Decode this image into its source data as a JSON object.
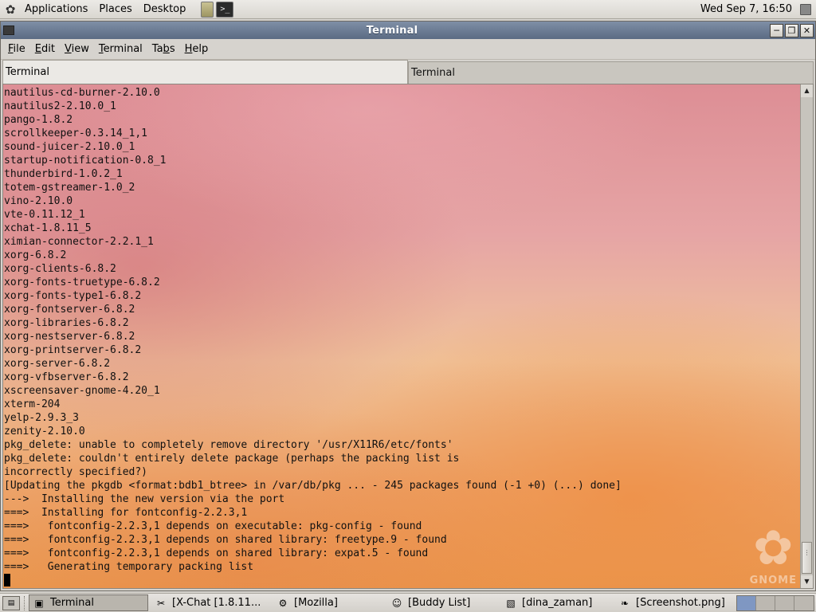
{
  "top_panel": {
    "menus": [
      "Applications",
      "Places",
      "Desktop"
    ],
    "clock": "Wed Sep  7, 16:50",
    "icons": [
      "gnome-foot-icon",
      "notes-launcher-icon",
      "terminal-launcher-icon",
      "tray-icon"
    ]
  },
  "window": {
    "title": "Terminal",
    "menubar": [
      {
        "label": "File",
        "mnemonic": "F",
        "rest": "ile"
      },
      {
        "label": "Edit",
        "mnemonic": "E",
        "rest": "dit"
      },
      {
        "label": "View",
        "mnemonic": "V",
        "rest": "iew"
      },
      {
        "label": "Terminal",
        "mnemonic": "T",
        "rest": "erminal"
      },
      {
        "label": "Tabs",
        "pre": "Ta",
        "mnemonic": "b",
        "rest": "s"
      },
      {
        "label": "Help",
        "mnemonic": "H",
        "rest": "elp"
      }
    ],
    "tabs": [
      "Terminal",
      "Terminal"
    ],
    "buttons": [
      "minimize",
      "maximize",
      "close"
    ]
  },
  "terminal": {
    "lines": [
      "nautilus-cd-burner-2.10.0",
      "nautilus2-2.10.0_1",
      "pango-1.8.2",
      "scrollkeeper-0.3.14_1,1",
      "sound-juicer-2.10.0_1",
      "startup-notification-0.8_1",
      "thunderbird-1.0.2_1",
      "totem-gstreamer-1.0_2",
      "vino-2.10.0",
      "vte-0.11.12_1",
      "xchat-1.8.11_5",
      "ximian-connector-2.2.1_1",
      "xorg-6.8.2",
      "xorg-clients-6.8.2",
      "xorg-fonts-truetype-6.8.2",
      "xorg-fonts-type1-6.8.2",
      "xorg-fontserver-6.8.2",
      "xorg-libraries-6.8.2",
      "xorg-nestserver-6.8.2",
      "xorg-printserver-6.8.2",
      "xorg-server-6.8.2",
      "xorg-vfbserver-6.8.2",
      "xscreensaver-gnome-4.20_1",
      "xterm-204",
      "yelp-2.9.3_3",
      "zenity-2.10.0",
      "pkg_delete: unable to completely remove directory '/usr/X11R6/etc/fonts'",
      "pkg_delete: couldn't entirely delete package (perhaps the packing list is",
      "incorrectly specified?)",
      "[Updating the pkgdb <format:bdb1_btree> in /var/db/pkg ... - 245 packages found (-1 +0) (...) done]",
      "--->  Installing the new version via the port",
      "===>  Installing for fontconfig-2.2.3,1",
      "===>   fontconfig-2.2.3,1 depends on executable: pkg-config - found",
      "===>   fontconfig-2.2.3,1 depends on shared library: freetype.9 - found",
      "===>   fontconfig-2.2.3,1 depends on shared library: expat.5 - found",
      "===>   Generating temporary packing list"
    ],
    "watermark": "GNOME"
  },
  "taskbar": {
    "tasks": [
      {
        "label": "Terminal",
        "icon": "terminal-icon",
        "active": true
      },
      {
        "label": "[X-Chat [1.8.11...",
        "icon": "xchat-icon",
        "active": false
      },
      {
        "label": "[Mozilla]",
        "icon": "mozilla-icon",
        "active": false
      },
      {
        "label": "[Buddy List]",
        "icon": "buddy-list-icon",
        "active": false
      },
      {
        "label": "[dina_zaman]",
        "icon": "image-viewer-icon",
        "active": false
      },
      {
        "label": "[Screenshot.png]",
        "icon": "gimp-icon",
        "active": false
      }
    ],
    "workspaces": 4,
    "active_workspace": 1
  }
}
